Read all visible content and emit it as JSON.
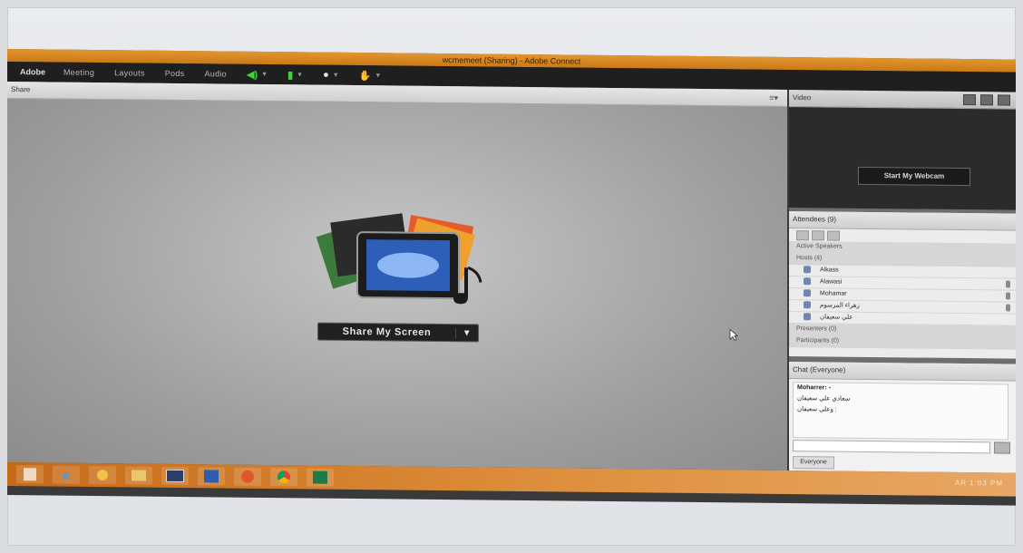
{
  "window": {
    "title": "wcmemeet (Sharing) - Adobe Connect"
  },
  "logo": {
    "text": "Adobe"
  },
  "menu": [
    {
      "label": "Meeting"
    },
    {
      "label": "Layouts"
    },
    {
      "label": "Pods"
    },
    {
      "label": "Audio"
    }
  ],
  "toolbar_icons": [
    "speaker-icon",
    "microphone-icon",
    "camera-icon",
    "raise-hand-icon"
  ],
  "share": {
    "title": "Share",
    "button_label": "Share My Screen"
  },
  "video": {
    "title": "Video",
    "start_webcam_label": "Start My Webcam"
  },
  "attendees": {
    "title": "Attendees",
    "count": "(9)",
    "active_speakers": "Active Speakers",
    "groups": [
      {
        "label": "Hosts (4)"
      },
      {
        "label": "Presenters (0)"
      },
      {
        "label": "Participants (0)"
      }
    ],
    "hosts": [
      {
        "name": "Alkass"
      },
      {
        "name": "Alawasi"
      },
      {
        "name": "Mohamar"
      },
      {
        "name": "زهراء المرسوم"
      },
      {
        "name": "علي سعيفان"
      }
    ]
  },
  "chat": {
    "title": "Chat",
    "subtitle": "(Everyone)",
    "messages": [
      {
        "text": "Moharrer: -",
        "sender": true
      },
      {
        "text": "سعادي علي سعيفان"
      },
      {
        "text": "وعلي سعيفان :"
      }
    ],
    "tab_label": "Everyone"
  },
  "taskbar": {
    "apps": [
      "windows-start-icon",
      "internet-explorer-icon",
      "media-icon",
      "file-explorer-icon",
      "photo-viewer-icon",
      "word-icon",
      "firefox-icon",
      "chrome-icon",
      "excel-icon"
    ],
    "tray_text": "AR 1:03 PM"
  },
  "colors": {
    "title_orange": "#d9892a",
    "menubar": "#1f1f1f",
    "share_gray": "#b3b3b3",
    "taskbar_orange": "#d17a27"
  }
}
